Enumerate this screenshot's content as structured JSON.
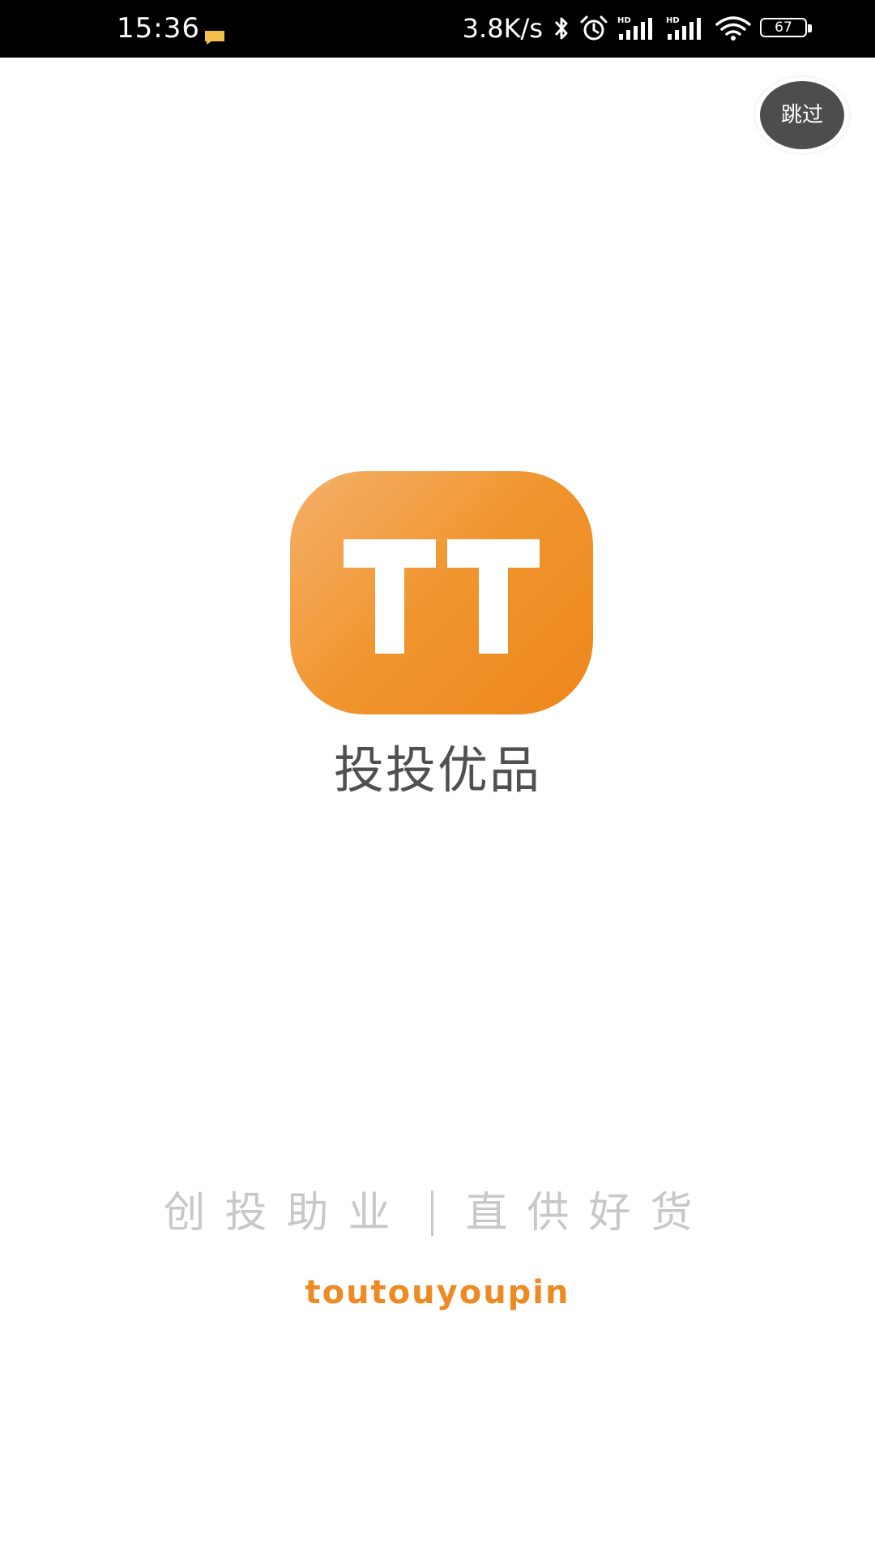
{
  "status_bar": {
    "time": "15:36",
    "net_speed": "3.8K/s",
    "battery_level": "67",
    "icons": [
      "message-notification-icon",
      "bluetooth-icon",
      "alarm-icon",
      "hd-signal-icon",
      "hd-signal-icon",
      "wifi-icon",
      "battery-icon"
    ]
  },
  "splash": {
    "skip_label": "跳过",
    "logo_glyph": "TT",
    "app_name": "投投优品",
    "slogan_left": "创投助业",
    "slogan_right": "直供好货",
    "brand_en": "toutouyoupin"
  },
  "colors": {
    "brand_orange": "#f0952e",
    "brand_text_orange": "#ee8a24",
    "skip_bg": "#4d4d4d",
    "app_name_gray": "#505050",
    "slogan_gray": "#c8c8c8"
  }
}
